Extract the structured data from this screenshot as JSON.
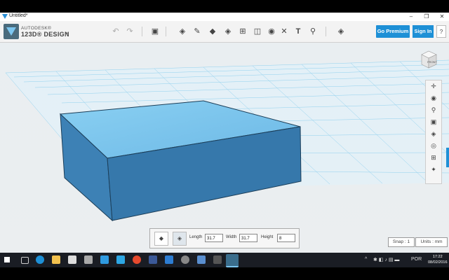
{
  "window": {
    "title": "Untitled*",
    "minimize": "–",
    "maximize": "❐",
    "close": "✕"
  },
  "brand": {
    "line1": "AUTODESK®",
    "line2": "123D® DESIGN",
    "menu_chevron": "⌄"
  },
  "toolbar": {
    "undo": "↶",
    "redo": "↷",
    "icons": [
      "primitives-icon",
      "sketch-icon",
      "construct-icon",
      "modify-icon",
      "pattern-icon",
      "group-icon",
      "combine-icon",
      "measure-icon",
      "text-icon",
      "snap-icon",
      "material-icon"
    ],
    "x_label": "✕",
    "t_label": "T"
  },
  "header_buttons": {
    "go_premium": "Go Premium",
    "sign_in": "Sign In",
    "help": "?"
  },
  "viewcube": {
    "face_label": "FRONT"
  },
  "sidebar": {
    "icons": [
      "pan-icon",
      "orbit-icon",
      "zoom-icon",
      "fit-icon",
      "view-mode-icon",
      "visibility-icon",
      "grid-icon",
      "material-icon"
    ]
  },
  "dimensions": {
    "length_label": "Length",
    "length_value": "31.7",
    "width_label": "Width",
    "width_value": "31.7",
    "height_label": "Height",
    "height_value": "8"
  },
  "status": {
    "snap": "Snap : 1",
    "units": "Units : mm"
  },
  "clock": {
    "time": "17:22",
    "date": "08/02/2016"
  },
  "tray": {
    "language": "POR",
    "chevron": "^"
  },
  "colors": {
    "accent": "#1e90d6",
    "box_top": "#7fc6ec",
    "box_side": "#3a7fb3",
    "grid": "#8fd0ee"
  }
}
